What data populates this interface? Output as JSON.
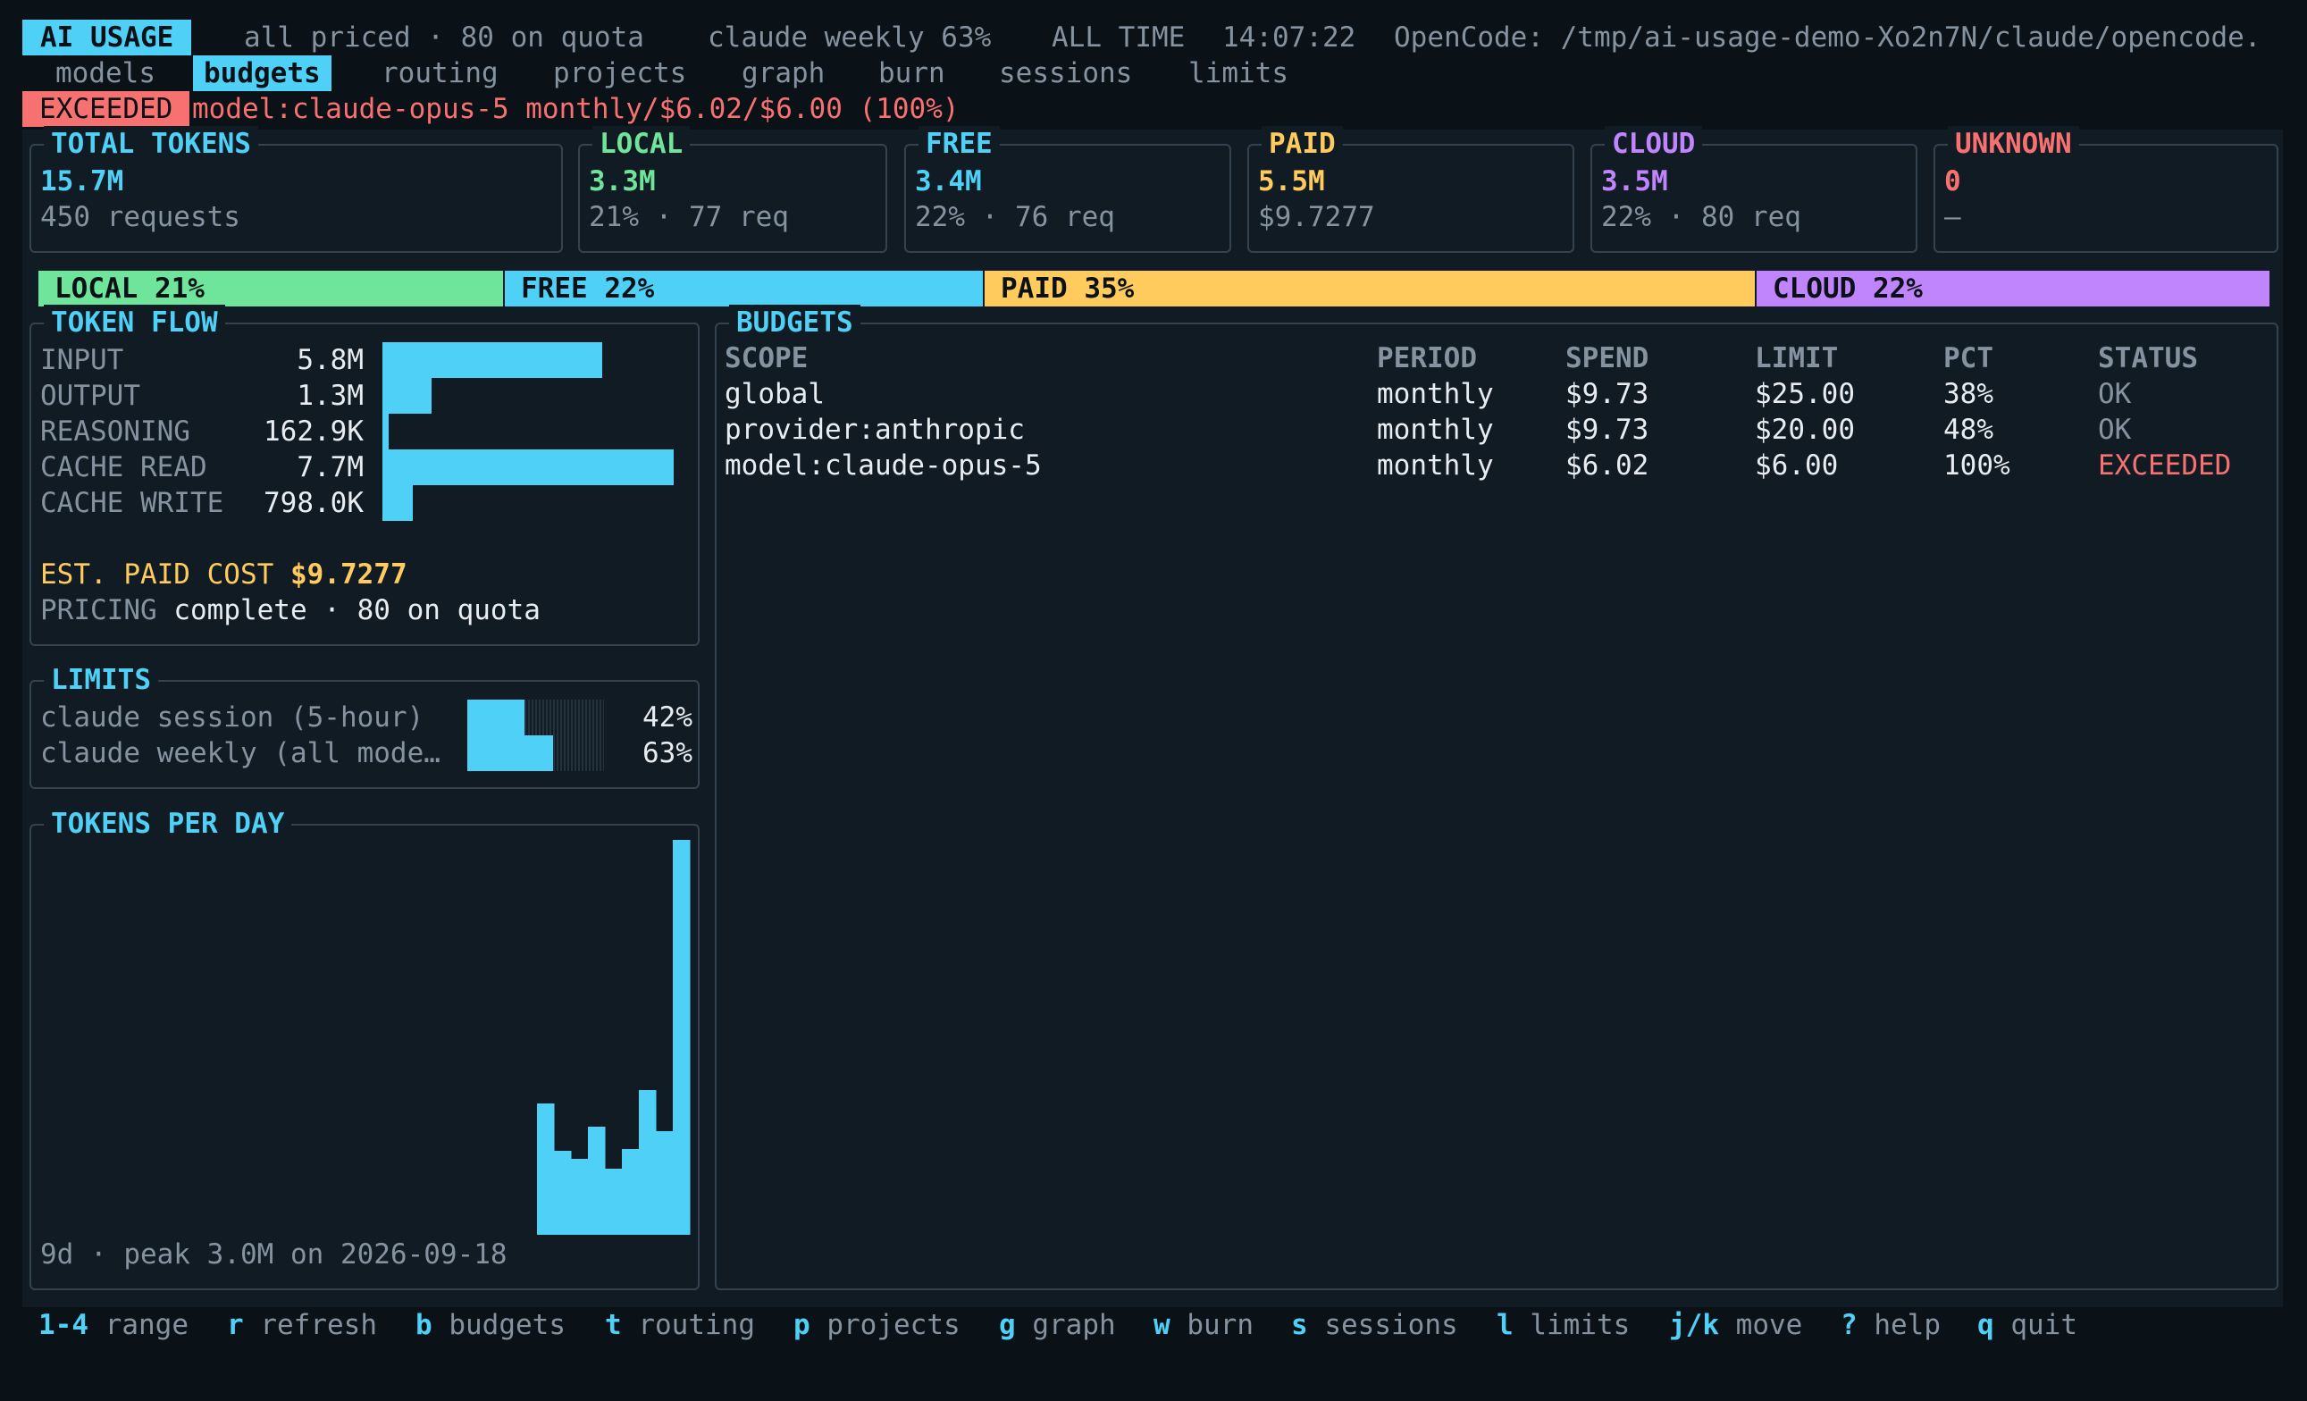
{
  "app": {
    "title": "AI USAGE",
    "status": "all priced · 80 on quota",
    "weekly": "claude weekly 63%",
    "range": "ALL TIME",
    "time": "14:07:22",
    "source": "OpenCode: /tmp/ai-usage-demo-Xo2n7N/claude/opencode."
  },
  "tabs": [
    {
      "label": "models",
      "active": false
    },
    {
      "label": "budgets",
      "active": true
    },
    {
      "label": "routing",
      "active": false
    },
    {
      "label": "projects",
      "active": false
    },
    {
      "label": "graph",
      "active": false
    },
    {
      "label": "burn",
      "active": false
    },
    {
      "label": "sessions",
      "active": false
    },
    {
      "label": "limits",
      "active": false
    }
  ],
  "alert": {
    "badge": "EXCEEDED",
    "message": "model:claude-opus-5 monthly/$6.02/$6.00 (100%)"
  },
  "cards": [
    {
      "title": "TOTAL TOKENS",
      "value": "15.7M",
      "sub": "450 requests",
      "color": "#4fd1f7"
    },
    {
      "title": "LOCAL",
      "value": "3.3M",
      "sub": "21% · 77 req",
      "color": "#6ee59a"
    },
    {
      "title": "FREE",
      "value": "3.4M",
      "sub": "22% · 76 req",
      "color": "#4fd1f7"
    },
    {
      "title": "PAID",
      "value": "5.5M",
      "sub": "$9.7277",
      "color": "#ffcb5c"
    },
    {
      "title": "CLOUD",
      "value": "3.5M",
      "sub": "22% · 80 req",
      "color": "#c084fc"
    },
    {
      "title": "UNKNOWN",
      "value": "0",
      "sub": "—",
      "color": "#f87171"
    }
  ],
  "split": [
    {
      "label": "LOCAL 21%",
      "share": 21,
      "color": "#6ee59a"
    },
    {
      "label": "FREE 22%",
      "share": 22,
      "color": "#4fd1f7"
    },
    {
      "label": "PAID 35%",
      "share": 35,
      "color": "#ffcb5c"
    },
    {
      "label": "CLOUD 22%",
      "share": 22,
      "color": "#c084fc"
    }
  ],
  "token_flow": {
    "title": "TOKEN FLOW",
    "rows": [
      {
        "label": "INPUT",
        "value": "5.8M",
        "amount": 5.8
      },
      {
        "label": "OUTPUT",
        "value": "1.3M",
        "amount": 1.3
      },
      {
        "label": "REASONING",
        "value": "162.9K",
        "amount": 0.1629
      },
      {
        "label": "CACHE READ",
        "value": "7.7M",
        "amount": 7.7
      },
      {
        "label": "CACHE WRITE",
        "value": "798.0K",
        "amount": 0.798
      }
    ],
    "cost_label": "EST. PAID COST",
    "cost_value": "$9.7277",
    "pricing_label": "PRICING",
    "pricing_value": "complete · 80 on quota"
  },
  "limits": {
    "title": "LIMITS",
    "rows": [
      {
        "label": "claude session (5-hour)",
        "pct": "42%",
        "fraction": 0.42
      },
      {
        "label": "claude weekly (all mode…",
        "pct": "63%",
        "fraction": 0.63
      }
    ]
  },
  "tokens_per_day": {
    "title": "TOKENS PER DAY",
    "footer": "9d · peak 3.0M on 2026-09-18"
  },
  "chart_data": {
    "type": "bar",
    "title": "TOKENS PER DAY",
    "values": [
      1.0,
      0.64,
      0.58,
      0.82,
      0.5,
      0.65,
      1.1,
      0.79,
      3.0
    ],
    "peak": 3.0,
    "peak_date": "2026-09-18",
    "unit": "M"
  },
  "budgets": {
    "title": "BUDGETS",
    "columns": [
      "SCOPE",
      "PERIOD",
      "SPEND",
      "LIMIT",
      "PCT",
      "STATUS"
    ],
    "rows": [
      {
        "scope": "global",
        "period": "monthly",
        "spend": "$9.73",
        "limit": "$25.00",
        "pct": "38%",
        "status": "OK"
      },
      {
        "scope": "provider:anthropic",
        "period": "monthly",
        "spend": "$9.73",
        "limit": "$20.00",
        "pct": "48%",
        "status": "OK"
      },
      {
        "scope": "model:claude-opus-5",
        "period": "monthly",
        "spend": "$6.02",
        "limit": "$6.00",
        "pct": "100%",
        "status": "EXCEEDED"
      }
    ]
  },
  "footer": [
    {
      "key": "1-4",
      "label": "range"
    },
    {
      "key": "r",
      "label": "refresh"
    },
    {
      "key": "b",
      "label": "budgets"
    },
    {
      "key": "t",
      "label": "routing"
    },
    {
      "key": "p",
      "label": "projects"
    },
    {
      "key": "g",
      "label": "graph"
    },
    {
      "key": "w",
      "label": "burn"
    },
    {
      "key": "s",
      "label": "sessions"
    },
    {
      "key": "l",
      "label": "limits"
    },
    {
      "key": "j/k",
      "label": "move"
    },
    {
      "key": "?",
      "label": "help"
    },
    {
      "key": "q",
      "label": "quit"
    }
  ],
  "colors": {
    "accent": "#4fd1f7",
    "local": "#6ee59a",
    "paid": "#ffcb5c",
    "cloud": "#c084fc",
    "danger": "#f87171",
    "background": "#0a1117",
    "panel": "#111b24"
  }
}
